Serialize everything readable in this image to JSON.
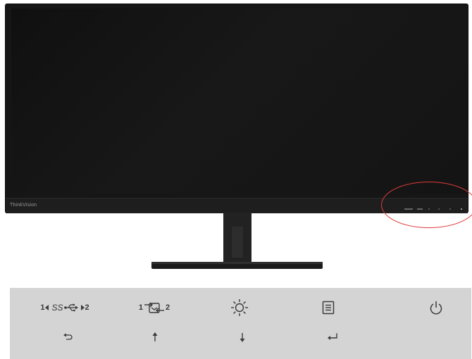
{
  "monitor": {
    "brand": "ThinkVision"
  },
  "buttons": {
    "usb_switch": {
      "left": "1",
      "right": "2",
      "ss": "SS"
    },
    "input_switch": {
      "left": "1",
      "right": "2"
    },
    "brightness": {
      "icon": "brightness-icon"
    },
    "menu": {
      "icon": "menu-icon"
    },
    "power": {
      "icon": "power-icon"
    }
  },
  "navigation": {
    "back": "back-arrow-icon",
    "up": "up-arrow-icon",
    "down": "down-arrow-icon",
    "enter": "enter-icon"
  },
  "colors": {
    "highlight": "#e03b3b",
    "panel": "#d4d4d4",
    "bezel": "#161616"
  }
}
